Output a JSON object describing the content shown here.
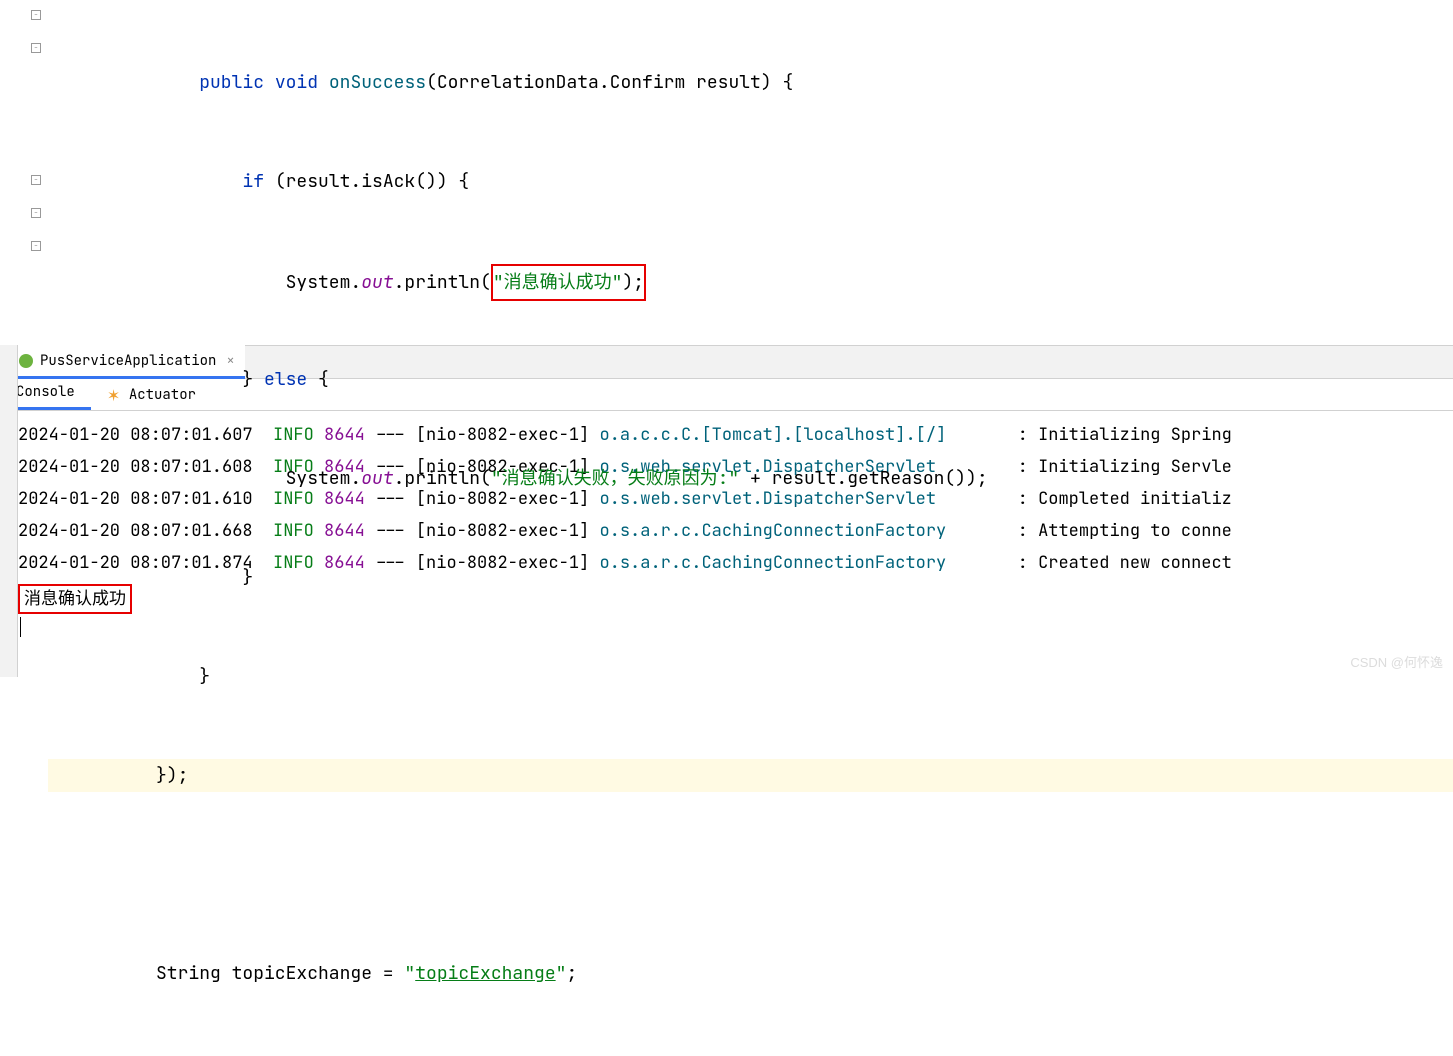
{
  "code": {
    "l1_kw1": "public",
    "l1_kw2": "void",
    "l1_method": "onSuccess",
    "l1_rest": "(CorrelationData.Confirm result) {",
    "l2_kw": "if",
    "l2_rest": " (result.isAck()) {",
    "l3_pre": "System.",
    "l3_out": "out",
    "l3_mid": ".println(",
    "l3_str": "\"消息确认成功\"",
    "l3_end": ");",
    "l4_brace": "} ",
    "l4_kw": "else",
    "l4_rest": " {",
    "l5_pre": "System.",
    "l5_out": "out",
    "l5_mid": ".println(",
    "l5_str": "\"消息确认失败，失败原因为:\"",
    "l5_plus": " + result.getReason());",
    "l6": "}",
    "l7": "}",
    "l8": "});",
    "l10_pre": "String topicExchange = ",
    "l10_str_q1": "\"",
    "l10_str_mid": "topicExchange",
    "l10_str_q2": "\"",
    "l10_end": ";"
  },
  "run_tab": {
    "label": "PusServiceApplication"
  },
  "sub_tabs": {
    "console": "Console",
    "actuator": "Actuator"
  },
  "console": {
    "lines": [
      {
        "ts": "2024-01-20 08:07:01.607",
        "level": "INFO",
        "pid": "8644",
        "thread": "[nio-8082-exec-1]",
        "logger": "o.a.c.c.C.[Tomcat].[localhost].[/]",
        "msg": "Initializing Spring"
      },
      {
        "ts": "2024-01-20 08:07:01.608",
        "level": "INFO",
        "pid": "8644",
        "thread": "[nio-8082-exec-1]",
        "logger": "o.s.web.servlet.DispatcherServlet",
        "msg": "Initializing Servle"
      },
      {
        "ts": "2024-01-20 08:07:01.610",
        "level": "INFO",
        "pid": "8644",
        "thread": "[nio-8082-exec-1]",
        "logger": "o.s.web.servlet.DispatcherServlet",
        "msg": "Completed initializ"
      },
      {
        "ts": "2024-01-20 08:07:01.668",
        "level": "INFO",
        "pid": "8644",
        "thread": "[nio-8082-exec-1]",
        "logger": "o.s.a.r.c.CachingConnectionFactory",
        "msg": "Attempting to conne"
      },
      {
        "ts": "2024-01-20 08:07:01.874",
        "level": "INFO",
        "pid": "8644",
        "thread": "[nio-8082-exec-1]",
        "logger": "o.s.a.r.c.CachingConnectionFactory",
        "msg": "Created new connect"
      }
    ],
    "boxed": "消息确认成功"
  },
  "watermark": "CSDN @何怀逸"
}
